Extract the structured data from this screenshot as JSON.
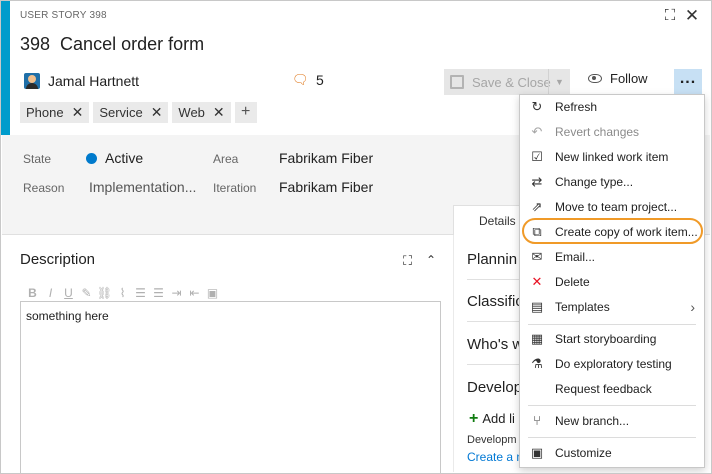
{
  "work_item": {
    "type_label": "USER STORY 398",
    "id": "398",
    "title": "Cancel order form",
    "assignee": "Jamal Hartnett",
    "discussion_count": "5",
    "tags": [
      "Phone",
      "Service",
      "Web"
    ]
  },
  "toolbar": {
    "save_label": "Save & Close",
    "follow_label": "Follow",
    "more_label": "..."
  },
  "fields": {
    "state_label": "State",
    "state_value": "Active",
    "reason_label": "Reason",
    "reason_value": "Implementation...",
    "area_label": "Area",
    "area_value": "Fabrikam Fiber",
    "iteration_label": "Iteration",
    "iteration_value": "Fabrikam Fiber"
  },
  "tabs": {
    "details": "Details"
  },
  "description": {
    "title": "Description",
    "content": "something here"
  },
  "right_sections": {
    "planning": "Plannin",
    "classification": "Classific",
    "whos": "Who's w",
    "development": "Develop",
    "add_link": "Add li",
    "dev_text": "Developm",
    "create_link": "Create a n"
  },
  "menu": {
    "items": [
      {
        "label": "Refresh",
        "icon": "refresh-icon"
      },
      {
        "label": "Revert changes",
        "icon": "undo-icon"
      },
      {
        "label": "New linked work item",
        "icon": "linked-item-icon"
      },
      {
        "label": "Change type...",
        "icon": "change-type-icon"
      },
      {
        "label": "Move to team project...",
        "icon": "move-icon"
      },
      {
        "label": "Create copy of work item...",
        "icon": "copy-icon"
      },
      {
        "label": "Email...",
        "icon": "email-icon"
      },
      {
        "label": "Delete",
        "icon": "delete-icon"
      },
      {
        "label": "Templates",
        "icon": "templates-icon"
      },
      {
        "label": "Start storyboarding",
        "icon": "storyboard-icon"
      },
      {
        "label": "Do exploratory testing",
        "icon": "testing-icon"
      },
      {
        "label": "Request feedback",
        "icon": "feedback-icon"
      },
      {
        "label": "New branch...",
        "icon": "branch-icon"
      },
      {
        "label": "Customize",
        "icon": "customize-icon"
      }
    ]
  },
  "colors": {
    "accent": "#009ccc",
    "state_active": "#007acc",
    "highlight": "#f09a28",
    "link": "#0078d4",
    "delete": "#e81123"
  }
}
